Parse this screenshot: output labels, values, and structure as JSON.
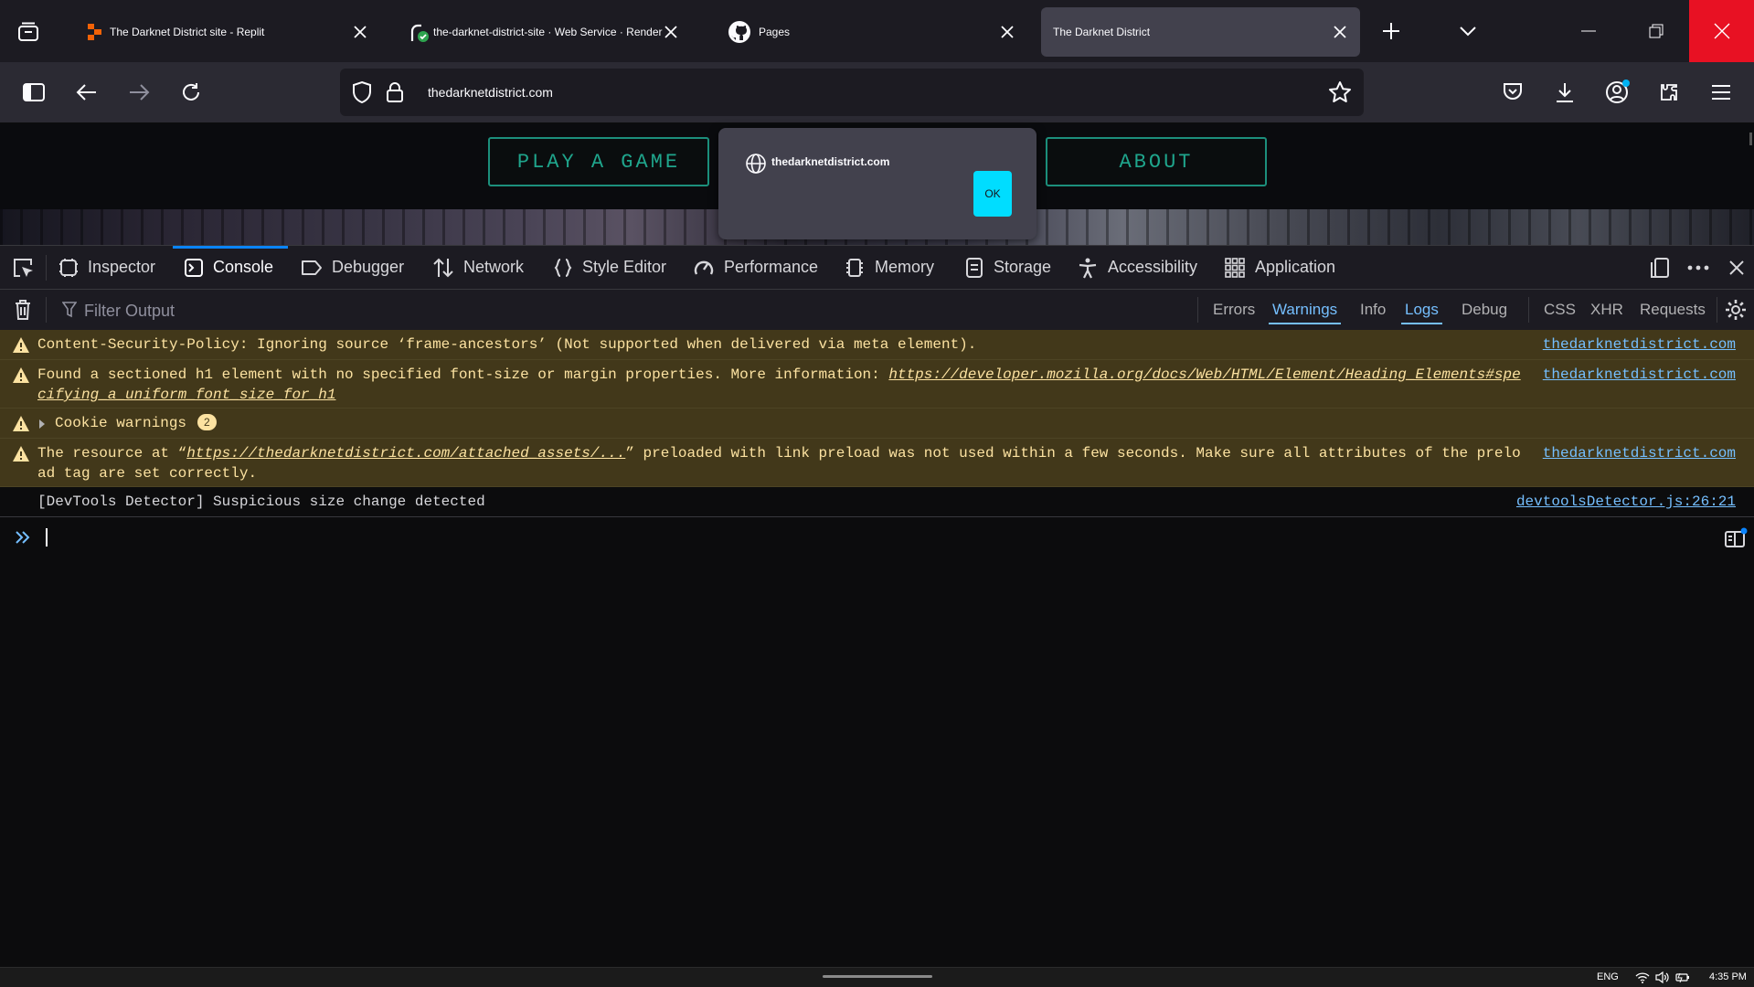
{
  "browser": {
    "tabs": [
      {
        "label": "The Darknet District site - Replit",
        "selected": false,
        "favicon": "replit-icon"
      },
      {
        "label": "the-darknet-district-site · Web Service · Render",
        "selected": false,
        "favicon": "render-icon"
      },
      {
        "label": "Pages",
        "selected": false,
        "favicon": "github-icon"
      },
      {
        "label": "The Darknet District",
        "selected": true,
        "favicon": "none"
      }
    ],
    "url": "thedarknetdistrict.com"
  },
  "page": {
    "buttons": {
      "play": "PLAY A GAME",
      "about": "ABOUT"
    },
    "dialog": {
      "origin": "thedarknetdistrict.com",
      "ok": "OK"
    }
  },
  "devtools": {
    "tabs": [
      {
        "label": "Inspector",
        "icon": "inspector-icon"
      },
      {
        "label": "Console",
        "icon": "console-icon",
        "active": true
      },
      {
        "label": "Debugger",
        "icon": "debugger-icon"
      },
      {
        "label": "Network",
        "icon": "network-icon"
      },
      {
        "label": "Style Editor",
        "icon": "style-editor-icon"
      },
      {
        "label": "Performance",
        "icon": "performance-icon"
      },
      {
        "label": "Memory",
        "icon": "memory-icon"
      },
      {
        "label": "Storage",
        "icon": "storage-icon"
      },
      {
        "label": "Accessibility",
        "icon": "accessibility-icon"
      },
      {
        "label": "Application",
        "icon": "application-icon"
      }
    ],
    "filter_placeholder": "Filter Output",
    "filters": {
      "errors": "Errors",
      "warnings": "Warnings",
      "info": "Info",
      "logs": "Logs",
      "debug": "Debug",
      "css": "CSS",
      "xhr": "XHR",
      "requests": "Requests"
    },
    "messages": [
      {
        "type": "warning",
        "text": "Content-Security-Policy: Ignoring source ‘frame-ancestors’ (Not supported when delivered via meta element).",
        "source": "thedarknetdistrict.com"
      },
      {
        "type": "warning",
        "text_before": "Found a sectioned h1 element with no specified font-size or margin properties. More information: ",
        "link": "https://developer.mozilla.org/docs/Web/HTML/Element/Heading_Elements#specifying_a_uniform_font_size_for_h1",
        "source": "thedarknetdistrict.com"
      },
      {
        "type": "warning-group",
        "text": "Cookie warnings",
        "count": "2"
      },
      {
        "type": "warning",
        "text_before": "The resource at “",
        "link": "https://thedarknetdistrict.com/attached_assets/...",
        "text_after": "” preloaded with link preload was not used within a few seconds. Make sure all attributes of the preload tag are set correctly.",
        "source": "thedarknetdistrict.com"
      },
      {
        "type": "log",
        "text": "[DevTools Detector] Suspicious size change detected",
        "source": "devtoolsDetector.js:26:21"
      }
    ]
  },
  "taskbar": {
    "language": "ENG",
    "time": "4:35 PM"
  }
}
